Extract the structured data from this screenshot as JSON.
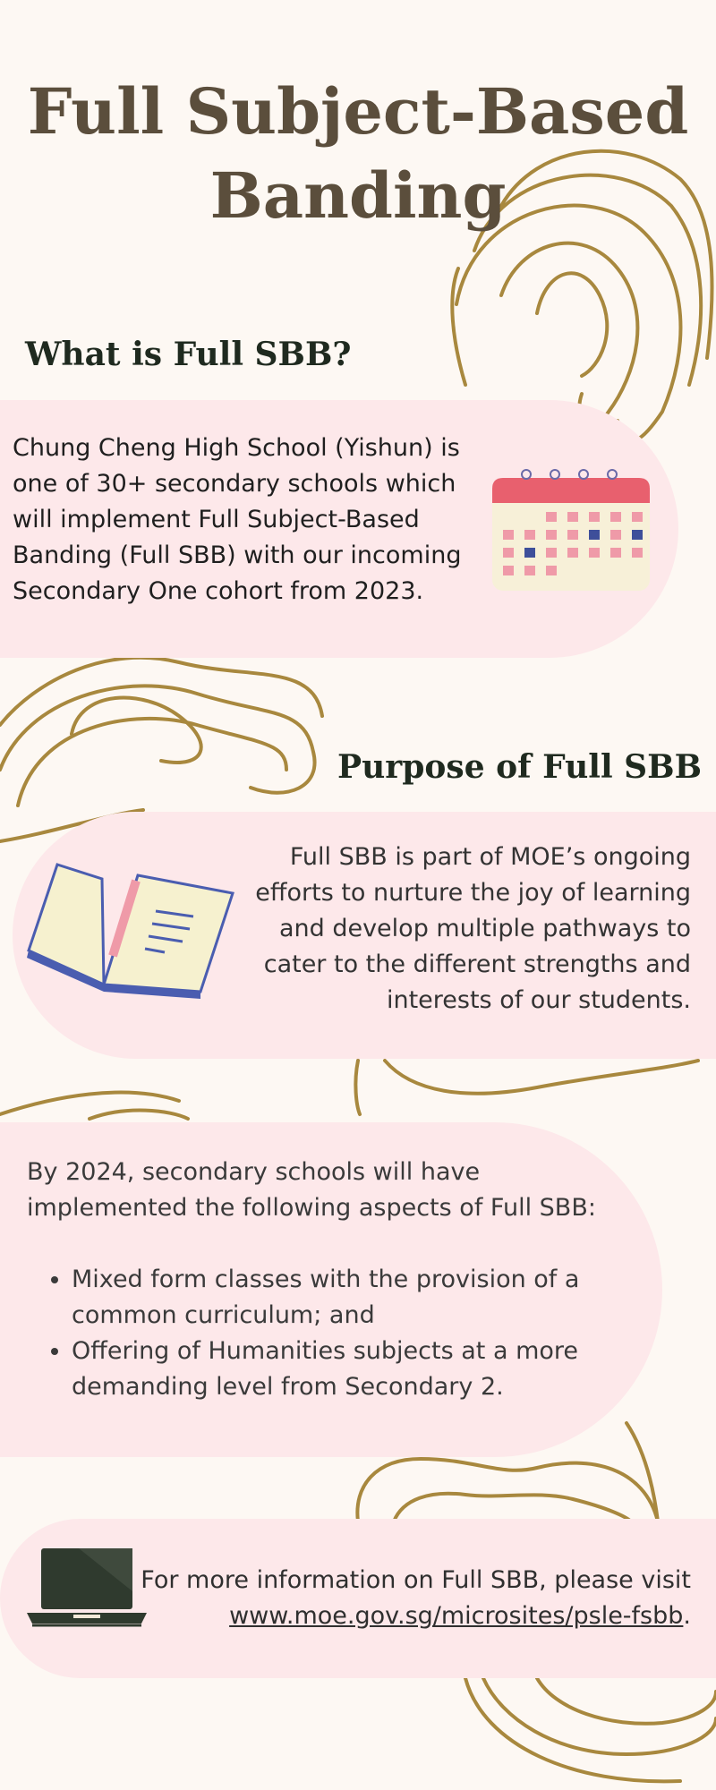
{
  "title": {
    "line1": "Full Subject-Based",
    "line2": "Banding"
  },
  "section1": {
    "heading": "What is Full SBB?",
    "body": "Chung Cheng High School (Yishun) is one of 30+ secondary schools which will implement Full Subject-Based Banding (Full SBB) with our incoming Secondary One cohort from 2023."
  },
  "section2": {
    "heading": "Purpose of Full SBB",
    "body": "Full SBB is part of MOE’s ongoing efforts to nurture the joy of learning and develop multiple pathways to cater to the different strengths and interests of our students."
  },
  "section3": {
    "intro": "By 2024, secondary schools will have implemented the following aspects of Full SBB:",
    "bullets": [
      "Mixed form classes with the provision of a common curriculum; and",
      "Offering of Humanities subjects at a more demanding level from Secondary 2."
    ]
  },
  "section4": {
    "text_before": "For more information on Full SBB, please visit ",
    "link": "www.moe.gov.sg/microsites/psle-fsbb",
    "text_after": "."
  },
  "icons": {
    "calendar": "calendar-icon",
    "book": "open-book-icon",
    "laptop": "laptop-icon"
  },
  "colors": {
    "background": "#fdf8f3",
    "pill": "#fde8ea",
    "title": "#5b4e3c",
    "heading": "#1f2a1f",
    "topo_line": "#a8883e"
  }
}
